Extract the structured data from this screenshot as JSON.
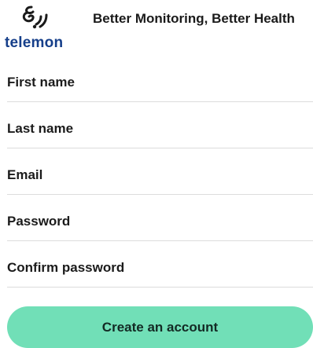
{
  "brand": {
    "logo_text": "telemon",
    "logo_icon": "telemon-waves-icon",
    "tagline": "Better Monitoring, Better Health",
    "colors": {
      "logo_text": "#163f8a",
      "logo_mark": "#1b1b1b"
    }
  },
  "form": {
    "first_name": {
      "placeholder": "First name",
      "value": ""
    },
    "last_name": {
      "placeholder": "Last name",
      "value": ""
    },
    "email": {
      "placeholder": "Email",
      "value": ""
    },
    "password": {
      "placeholder": "Password",
      "value": ""
    },
    "confirm_password": {
      "placeholder": "Confirm password",
      "value": ""
    }
  },
  "submit": {
    "label": "Create an account",
    "color": "#71dfb7"
  }
}
